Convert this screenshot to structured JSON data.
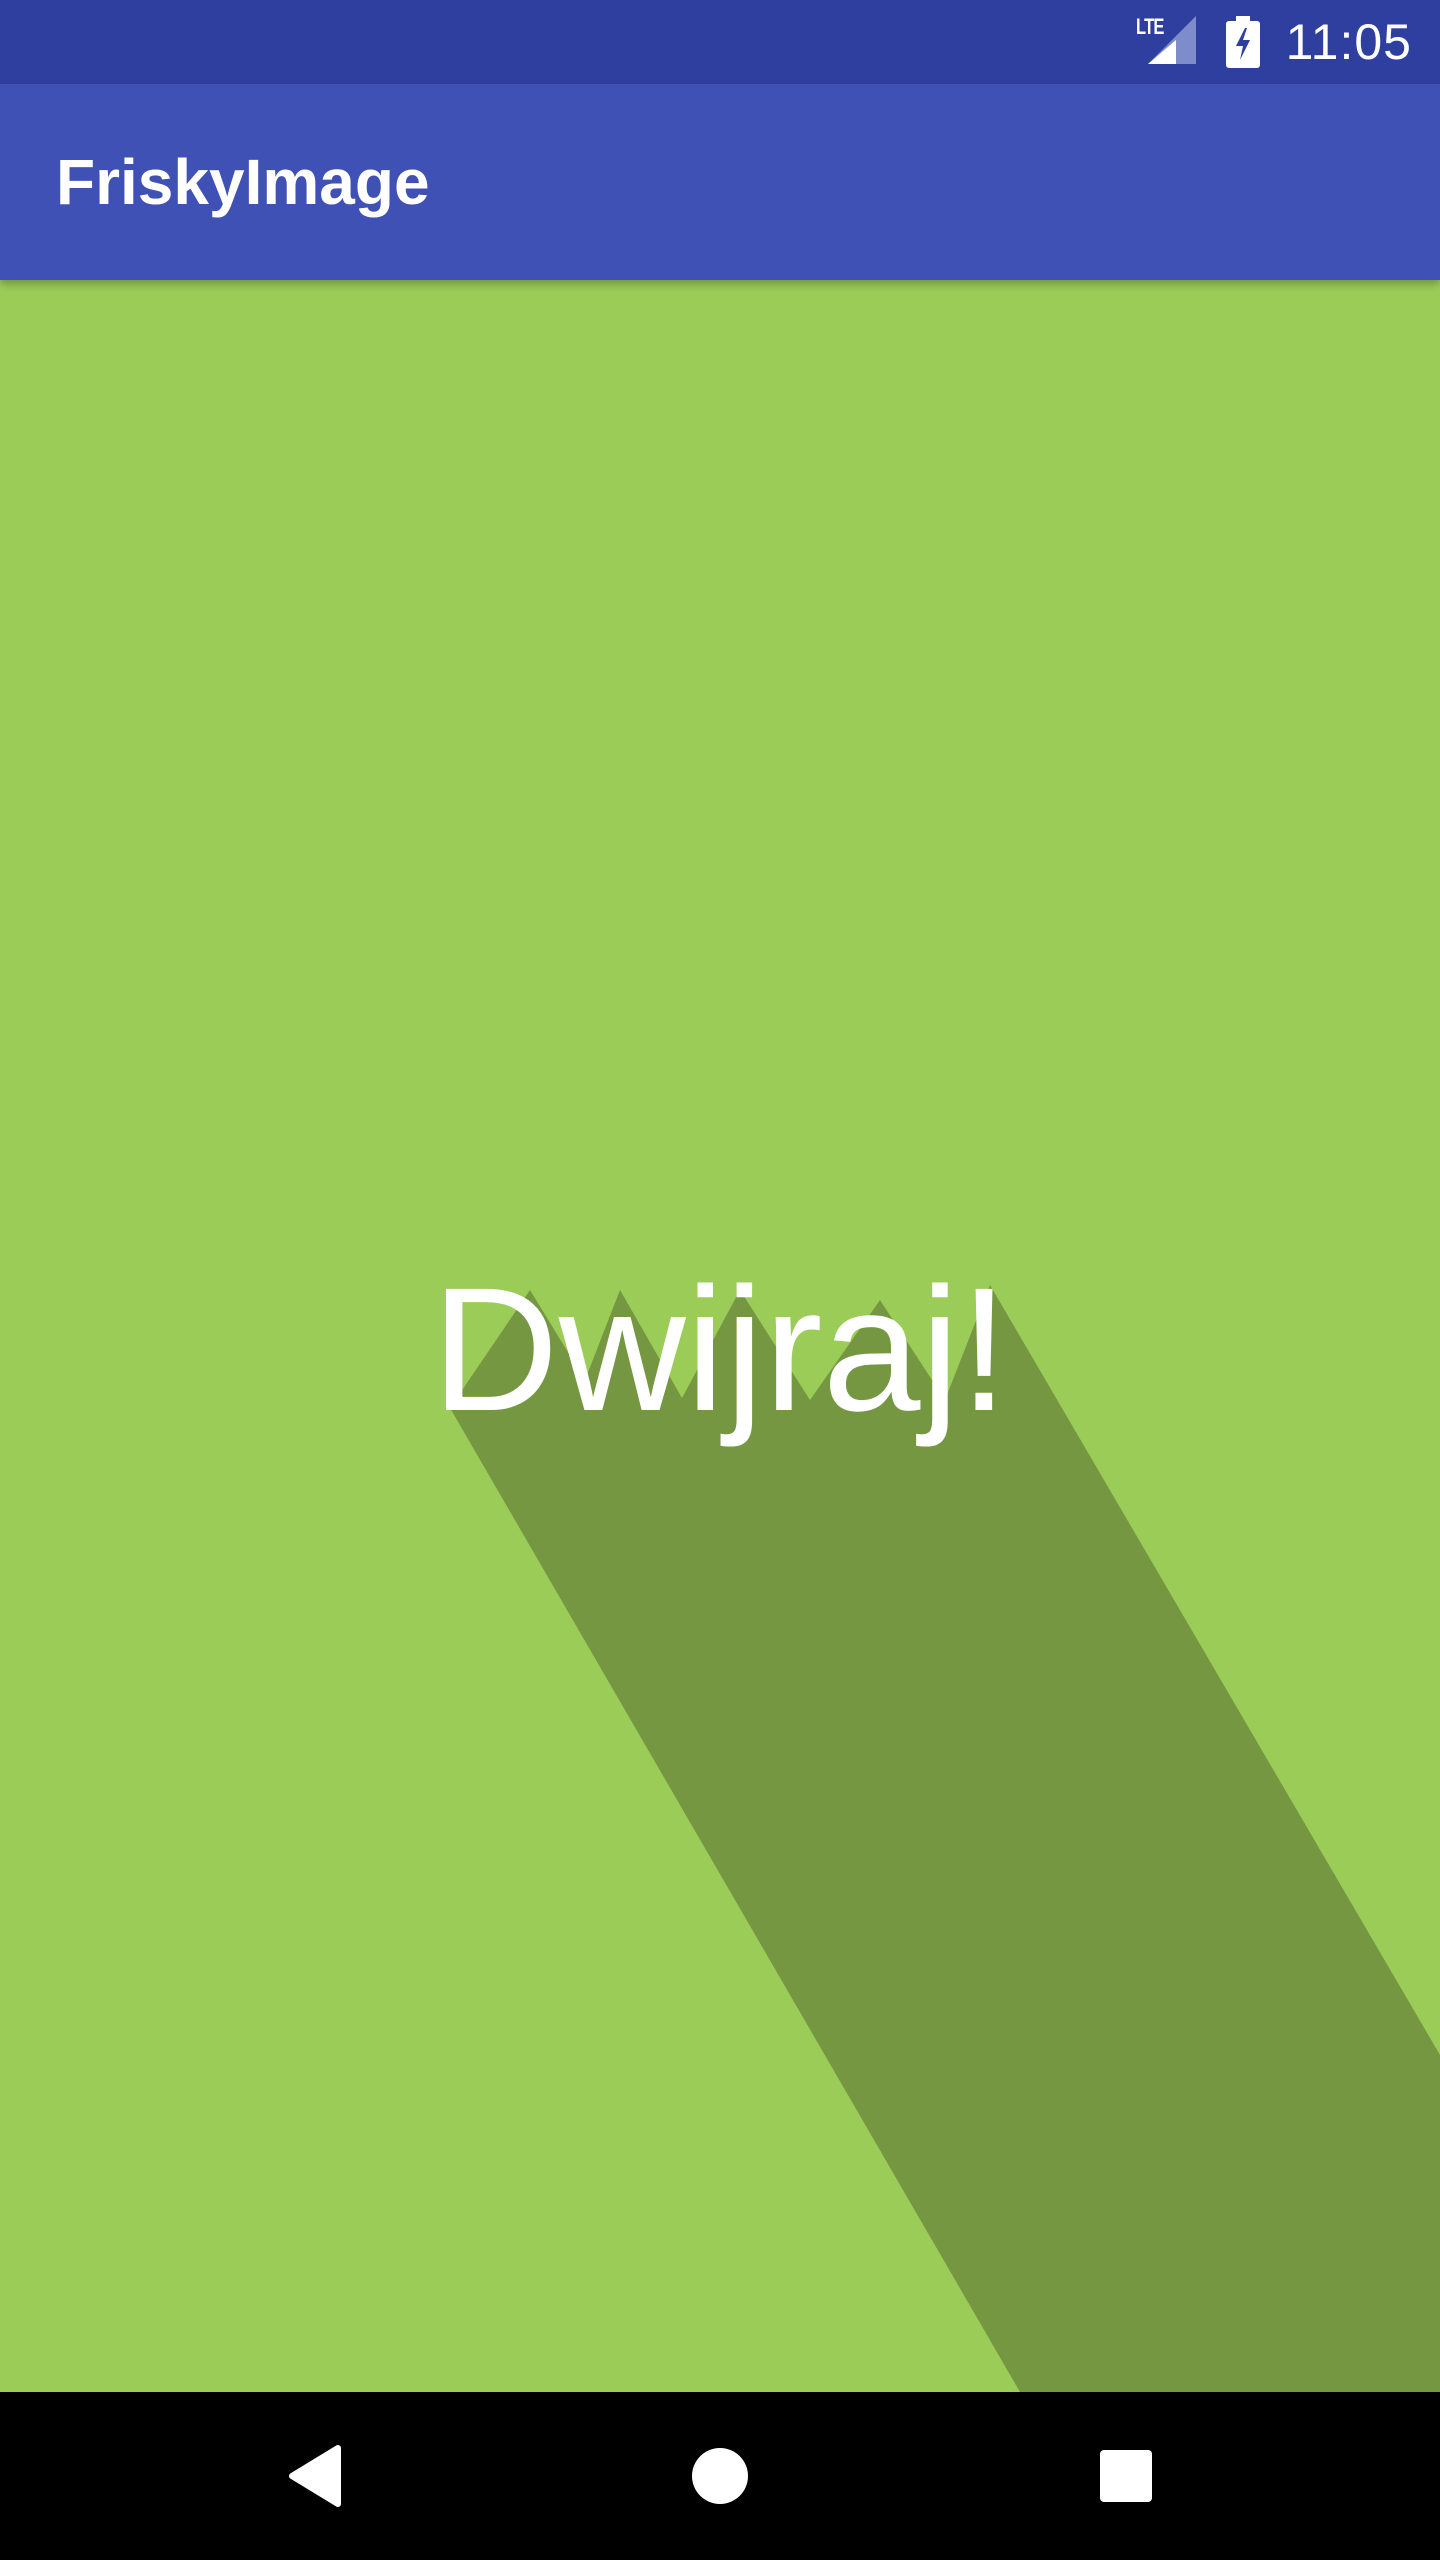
{
  "status_bar": {
    "network_type": "LTE",
    "time": "11:05",
    "icons": [
      "lte-signal-icon",
      "battery-charging-icon"
    ]
  },
  "app_bar": {
    "title": "FriskyImage"
  },
  "content": {
    "main_text": "Dwijraj!"
  },
  "nav_bar": {
    "icons": [
      "back-icon",
      "home-icon",
      "recents-icon"
    ]
  },
  "colors": {
    "status_bar": "#2f3f9f",
    "app_bar": "#3f51b5",
    "background": "#9ccc58",
    "long_shadow": "#759741",
    "text": "#ffffff",
    "nav_bar": "#000000"
  }
}
